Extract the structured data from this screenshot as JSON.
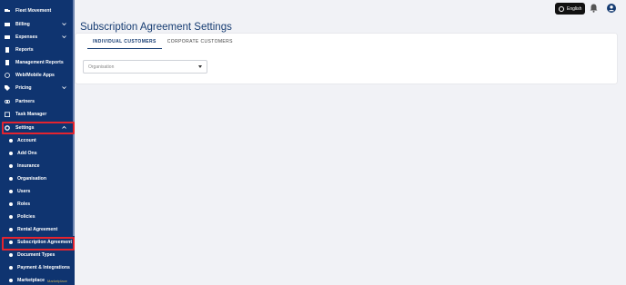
{
  "sidebar": {
    "items": [
      {
        "label": "Fleet Movement",
        "icon": "truck-icon",
        "chevron": false
      },
      {
        "label": "Billing",
        "icon": "billing-icon",
        "chevron": true
      },
      {
        "label": "Expenses",
        "icon": "wallet-icon",
        "chevron": true
      },
      {
        "label": "Reports",
        "icon": "report-icon",
        "chevron": false
      },
      {
        "label": "Management Reports",
        "icon": "report-icon",
        "chevron": false
      },
      {
        "label": "Web/Mobile Apps",
        "icon": "globe-icon",
        "chevron": false
      },
      {
        "label": "Pricing",
        "icon": "tag-icon",
        "chevron": true
      },
      {
        "label": "Partners",
        "icon": "handshake-icon",
        "chevron": false
      },
      {
        "label": "Task Manager",
        "icon": "calendar-icon",
        "chevron": false
      },
      {
        "label": "Settings",
        "icon": "gear-icon",
        "chevron": true
      }
    ],
    "sub_items": [
      "Account",
      "Add Ons",
      "Insurance",
      "Organisation",
      "Users",
      "Roles",
      "Policies",
      "Rental Agreement",
      "Subscription Agreement",
      "Document Types",
      "Payment & Integrations",
      "Marketplace"
    ]
  },
  "header": {
    "language_label": "English",
    "icons": [
      "globe-icon",
      "bell-icon",
      "user-icon"
    ]
  },
  "main": {
    "title": "Subscription Agreement Settings",
    "tabs": [
      "INDIVIDUAL CUSTOMERS",
      "CORPORATE CUSTOMERS"
    ],
    "active_tab": 0,
    "organisation_select": {
      "placeholder": "Organisation",
      "value": ""
    }
  },
  "watermark": "Marketplace",
  "colors": {
    "sidebar_bg": "#0f3470",
    "accent": "#163c72",
    "highlight": "#e4242f",
    "page_bg": "#f1f2f6"
  }
}
